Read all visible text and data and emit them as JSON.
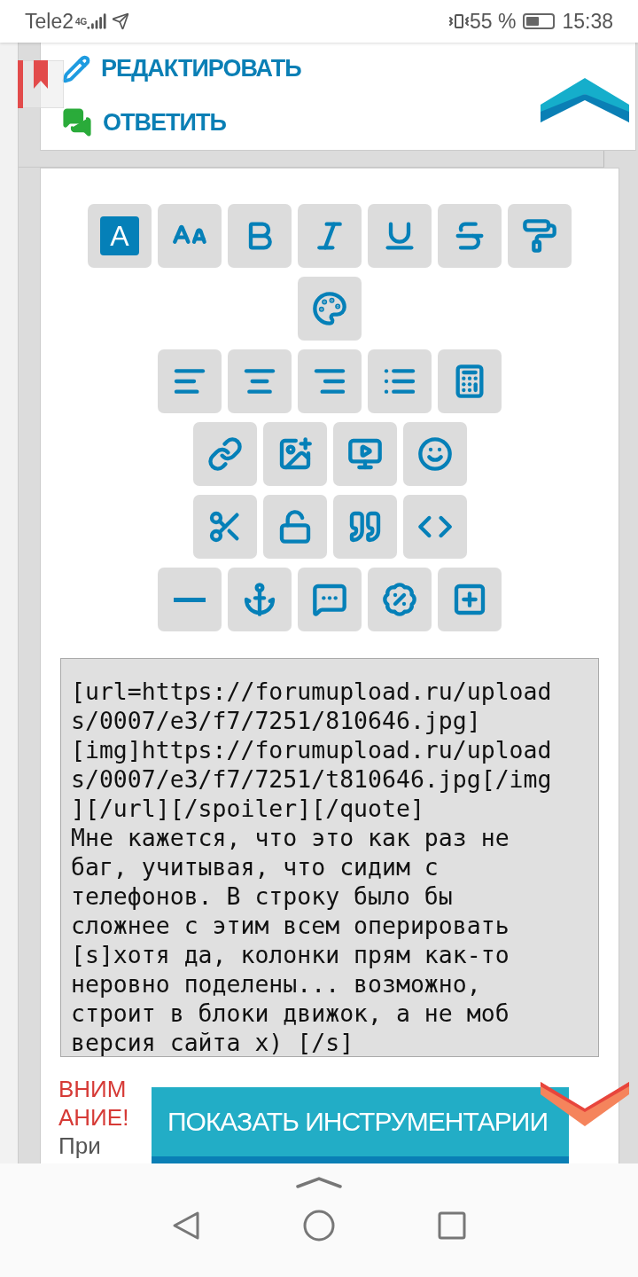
{
  "status_bar": {
    "carrier": "Tele2",
    "network": "4G",
    "battery_text": "55 %",
    "time": "15:38"
  },
  "post_actions": [
    {
      "label": "РЕДАКТИРОВАТЬ",
      "kind": "edit"
    },
    {
      "label": "ОТВЕТИТЬ",
      "kind": "reply"
    }
  ],
  "toolbar": {
    "font_icon_letter": "A"
  },
  "message_lines": [
    "[url=https://forumupload.ru/upload",
    "s/0007/e3/f7/7251/810646.jpg]",
    "[img]https://forumupload.ru/upload",
    "s/0007/e3/f7/7251/t810646.jpg[/img",
    "][/url][/spoiler][/quote]",
    "Мне кажется, что это как раз не",
    "баг, учитывая, что сидим с",
    "телефонов. В строку было бы",
    "сложнее с этим всем оперировать",
    "[s]хотя да, колонки прям как-то",
    "неровно поделены... возможно,",
    "строит в блоки движок, а не моб",
    "версия сайта х) [/s]"
  ],
  "warning": {
    "title": "ВНИМАНИЕ!",
    "text": "При"
  },
  "show_tools_button": "ПОКАЗАТЬ ИНСТРУМЕНТАРИИ"
}
